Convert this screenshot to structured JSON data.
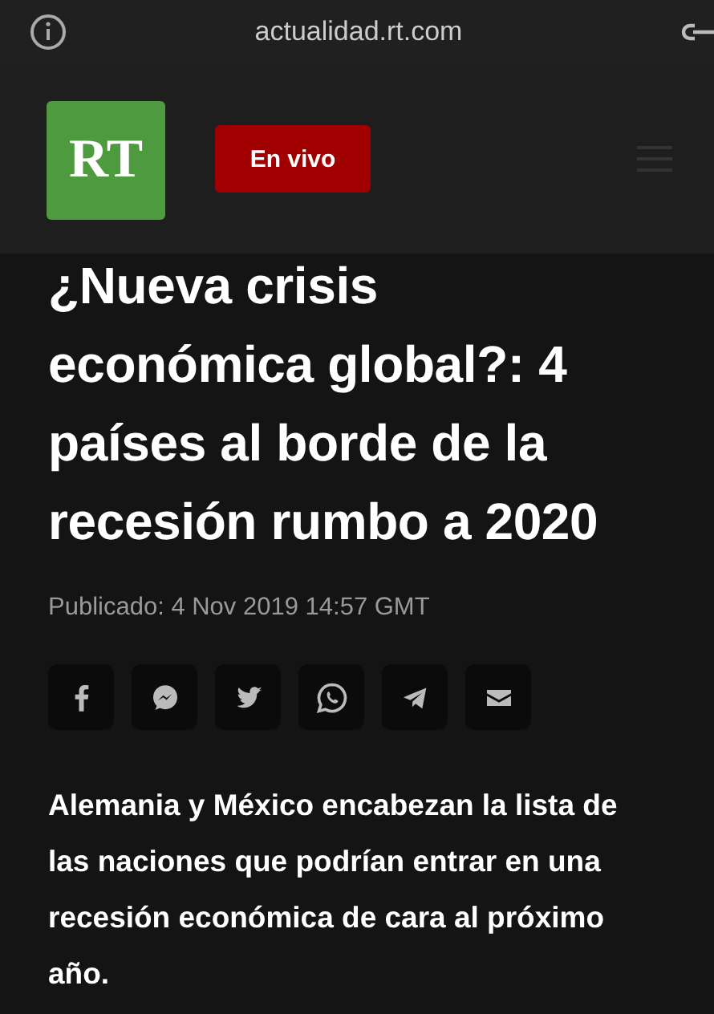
{
  "browser_bar": {
    "url": "actualidad.rt.com"
  },
  "header": {
    "logo_text": "RT",
    "live_button": "En vivo"
  },
  "article": {
    "title": "¿Nueva crisis económica global?: 4 países al borde de la recesión rumbo a 2020",
    "published": "Publicado: 4 Nov 2019 14:57 GMT",
    "share": [
      {
        "kind": "facebook"
      },
      {
        "kind": "messenger"
      },
      {
        "kind": "twitter"
      },
      {
        "kind": "whatsapp"
      },
      {
        "kind": "telegram"
      },
      {
        "kind": "email"
      }
    ],
    "lede": "Alemania y México encabezan la lista de las naciones que podrían entrar en una recesión económica de cara al próximo año."
  }
}
